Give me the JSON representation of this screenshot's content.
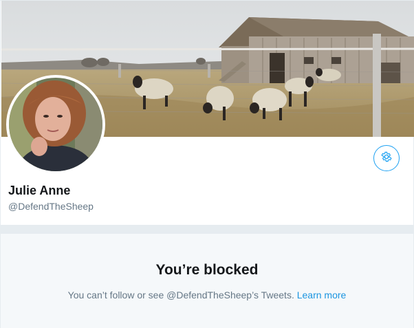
{
  "profile": {
    "display_name": "Julie Anne",
    "screen_name": "@DefendTheSheep",
    "banner_image": "farm-barn-sheep-photo",
    "avatar_image": "profile-photo-woman",
    "settings_icon": "gear-icon"
  },
  "blocked": {
    "title": "You’re blocked",
    "message": "You can’t follow or see @DefendTheSheep’s Tweets.",
    "link_label": "Learn more"
  },
  "colors": {
    "accent": "#1da1f2",
    "link": "#1b95e0",
    "primary_text": "#14171a",
    "secondary_text": "#657786",
    "background": "#e6ecf0",
    "panel_background": "#f5f8fa"
  }
}
